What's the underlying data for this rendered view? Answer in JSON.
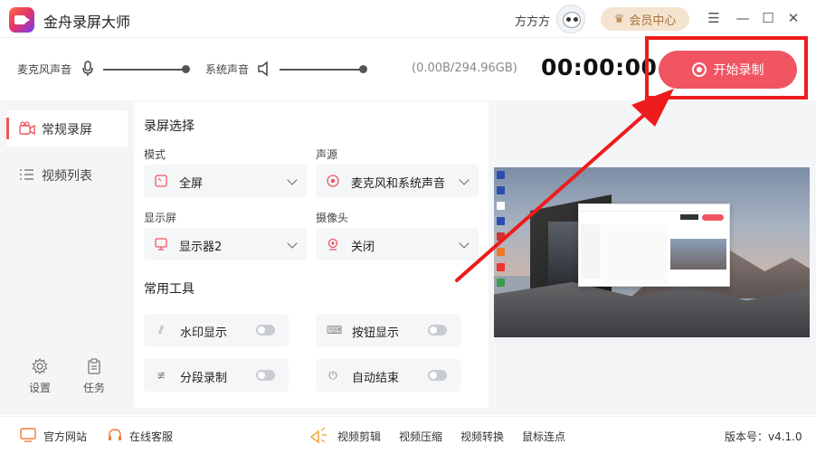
{
  "app": {
    "title": "金舟录屏大师"
  },
  "header": {
    "username": "方方方",
    "vip_label": "会员中心"
  },
  "audio": {
    "mic_label": "麦克风声音",
    "system_label": "系统声音",
    "mic_level": 1.0,
    "system_level": 1.0,
    "storage": "(0.00B/294.96GB)",
    "timer": "00:00:00",
    "record_label": "开始录制"
  },
  "sidebar": {
    "items": [
      {
        "label": "常规录屏",
        "active": true
      },
      {
        "label": "视频列表",
        "active": false
      }
    ],
    "bottom": [
      {
        "label": "设置"
      },
      {
        "label": "任务"
      }
    ]
  },
  "panel": {
    "screen_section": "录屏选择",
    "mode_label": "模式",
    "mode_value": "全屏",
    "audio_source_label": "声源",
    "audio_source_value": "麦克风和系统声音",
    "display_label": "显示屏",
    "display_value": "显示器2",
    "camera_label": "摄像头",
    "camera_value": "关闭",
    "tools_section": "常用工具",
    "tools": [
      {
        "label": "水印显示",
        "on": false
      },
      {
        "label": "按钮显示",
        "on": false
      },
      {
        "label": "分段录制",
        "on": false
      },
      {
        "label": "自动结束",
        "on": false
      }
    ]
  },
  "footer": {
    "website": "官方网站",
    "support": "在线客服",
    "links": [
      "视频剪辑",
      "视频压缩",
      "视频转换",
      "鼠标连点"
    ],
    "version": "版本号：v4.1.0"
  },
  "colors": {
    "accent": "#f05561",
    "highlight": "#ee1c1c",
    "vip_bg": "#f4e4cf",
    "vip_text": "#a8703a"
  }
}
